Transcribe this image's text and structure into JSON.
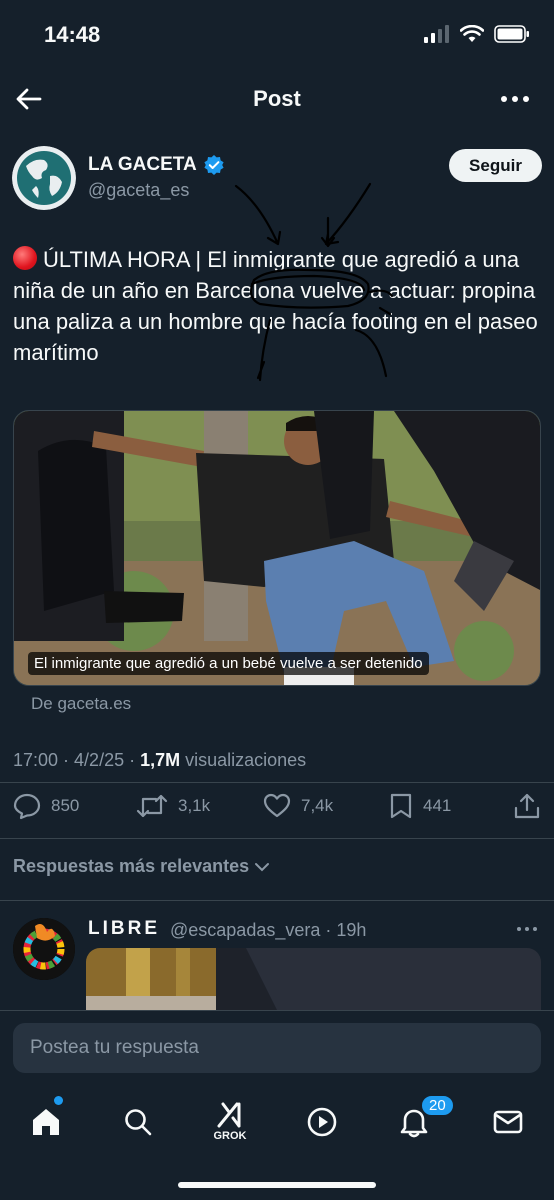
{
  "status_bar": {
    "time": "14:48"
  },
  "header": {
    "title": "Post"
  },
  "author": {
    "name": "LA GACETA",
    "handle": "@gaceta_es",
    "follow_label": "Seguir"
  },
  "post": {
    "text": "ÚLTIMA HORA | El inmigrante que agredió a una niña de un año en Barcelona vuelve a actuar: propina una paliza a un hombre que hacía footing en el paseo marítimo",
    "media_caption": "El inmigrante que agredió a un bebé vuelve a ser detenido",
    "source": "De gaceta.es",
    "timestamp": "17:00 · 4/2/25 · ",
    "views_count": "1,7M",
    "views_label": " visualizaciones"
  },
  "actions": {
    "replies": "850",
    "reposts": "3,1k",
    "likes": "7,4k",
    "bookmarks": "441"
  },
  "replies_header": {
    "label": "Respuestas más relevantes"
  },
  "reply": {
    "name": "LIBRE",
    "handle": "@escapadas_vera · 19h"
  },
  "compose": {
    "placeholder": "Postea tu respuesta"
  },
  "tab_bar": {
    "grok_label": "GROK",
    "notifications_count": "20"
  },
  "colors": {
    "background": "#15202b",
    "accent": "#1d9bf0",
    "muted": "#8b98a5"
  }
}
